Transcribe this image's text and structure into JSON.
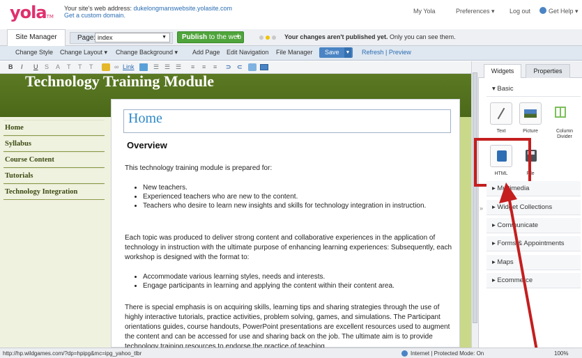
{
  "header": {
    "logo": "yola",
    "logo_tm": "TM",
    "address_prefix": "Your site's web address:",
    "address_url": "dukelongmanswebsite.yolasite.com",
    "custom_domain": "Get a custom domain.",
    "my_yola": "My Yola",
    "preferences": "Preferences ▾",
    "logout": "Log out",
    "get_help": "Get Help ▾"
  },
  "tabs": {
    "site_manager": "Site Manager",
    "page_label": "Page:",
    "page_value": "index",
    "publish_bold": "Publish",
    "publish_rest": " to the web",
    "unpublished_bold": "Your changes aren't published yet.",
    "unpublished_rest": " Only you can see them."
  },
  "menu": {
    "change_style": "Change Style",
    "change_layout": "Change Layout ▾",
    "change_background": "Change Background ▾",
    "add_page": "Add Page",
    "edit_navigation": "Edit Navigation",
    "file_manager": "File Manager",
    "save": "Save",
    "refresh_preview": "Refresh | Preview"
  },
  "format_toolbar": {
    "bold": "B",
    "italic": "I",
    "underline": "U",
    "link": "Link"
  },
  "site": {
    "title": "Technology Training Module",
    "nav": [
      "Home",
      "Syllabus",
      "Course Content",
      "Tutorials",
      "Technology Integration"
    ],
    "page_title": "Home",
    "heading": "Overview",
    "intro": "This technology training module is prepared for:",
    "list1": [
      "New teachers.",
      "Experienced teachers who are new to the content.",
      "Teachers who desire to learn new insights and skills for technology integration in instruction."
    ],
    "para2": "Each topic was produced to deliver strong content and collaborative experiences in the application of technology in instruction with the ultimate purpose of enhancing learning experiences: Subsequently, each workshop is designed with the format to:",
    "list2": [
      "Accommodate various learning styles, needs and interests.",
      "Engage participants in learning and applying the content within their content area."
    ],
    "para3": "There is special emphasis is on acquiring skills, learning tips and sharing strategies through the use of highly interactive tutorials, practice activities, problem solving, games, and simulations. The Participant orientations guides, course handouts, PowerPoint presentations are excellent resources used to augment the content and can be accessed for use and sharing back on the job. The ultimate aim is to provide technology training resources to endorse the practice of teaching"
  },
  "panel": {
    "tab_widgets": "Widgets",
    "tab_properties": "Properties",
    "basic": "Basic",
    "widgets": [
      "Text",
      "Picture",
      "Column Divider",
      "HTML",
      "File"
    ],
    "sections": [
      "Multimedia",
      "Widget Collections",
      "Communicate",
      "Forms & Appointments",
      "Maps",
      "Ecommerce"
    ]
  },
  "status": {
    "url": "http://hp.wildgames.com/?dp=hpipg&mc=ipg_yahoo_tlbr",
    "zone": "Internet | Protected Mode: On",
    "zoom": "100%"
  },
  "colors": {
    "yola_pink": "#e0306e",
    "publish_green": "#4fa43b",
    "banner_olive": "#5c7a24",
    "title_blue": "#2e88c7",
    "highlight_red": "#c41e1e"
  }
}
